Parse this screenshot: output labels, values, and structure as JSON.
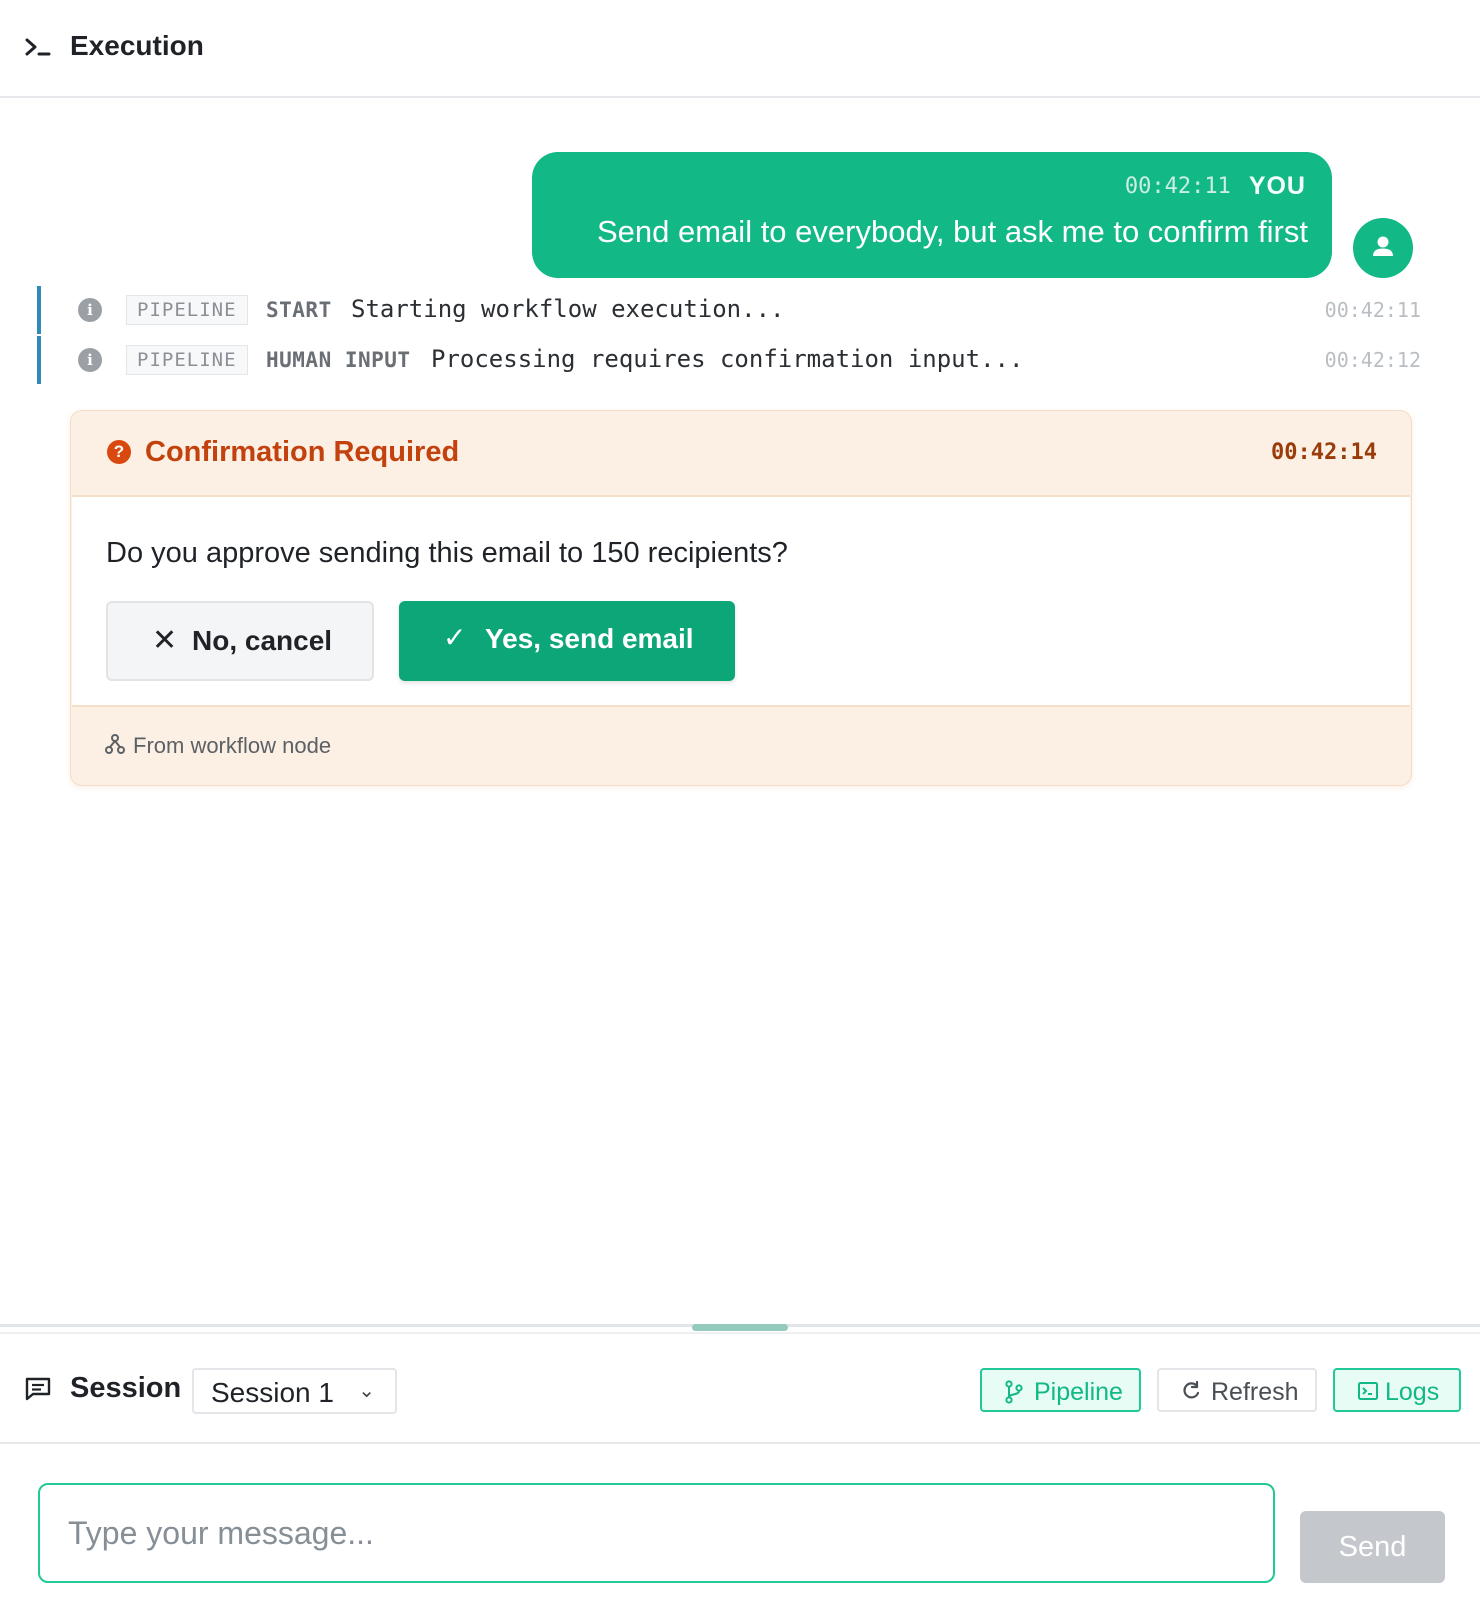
{
  "header": {
    "title": "Execution",
    "icon": "terminal-icon"
  },
  "user_message": {
    "time": "00:42:11",
    "author": "YOU",
    "text": "Send email to everybody, but ask me to confirm first",
    "avatar_icon": "user-icon"
  },
  "logs": [
    {
      "badge": "PIPELINE",
      "stage": "START",
      "message": "Starting workflow execution...",
      "time": "00:42:11"
    },
    {
      "badge": "PIPELINE",
      "stage": "HUMAN INPUT",
      "message": "Processing requires confirmation input...",
      "time": "00:42:12"
    }
  ],
  "confirmation": {
    "title": "Confirmation Required",
    "time": "00:42:14",
    "question": "Do you approve sending this email to 150 recipients?",
    "cancel_label": "No, cancel",
    "confirm_label": "Yes, send email",
    "footer": "From workflow node",
    "icon": "question-circle-icon"
  },
  "session": {
    "label": "Session",
    "selected": "Session 1",
    "buttons": {
      "pipeline": "Pipeline",
      "refresh": "Refresh",
      "logs": "Logs"
    }
  },
  "composer": {
    "placeholder": "Type your message...",
    "value": "",
    "send_label": "Send"
  },
  "colors": {
    "accent": "#12b886",
    "log_border": "#2f8ab6",
    "warning_bg": "#fcefe3",
    "warning_text": "#c2410c",
    "send_disabled": "#c4c8cc"
  }
}
